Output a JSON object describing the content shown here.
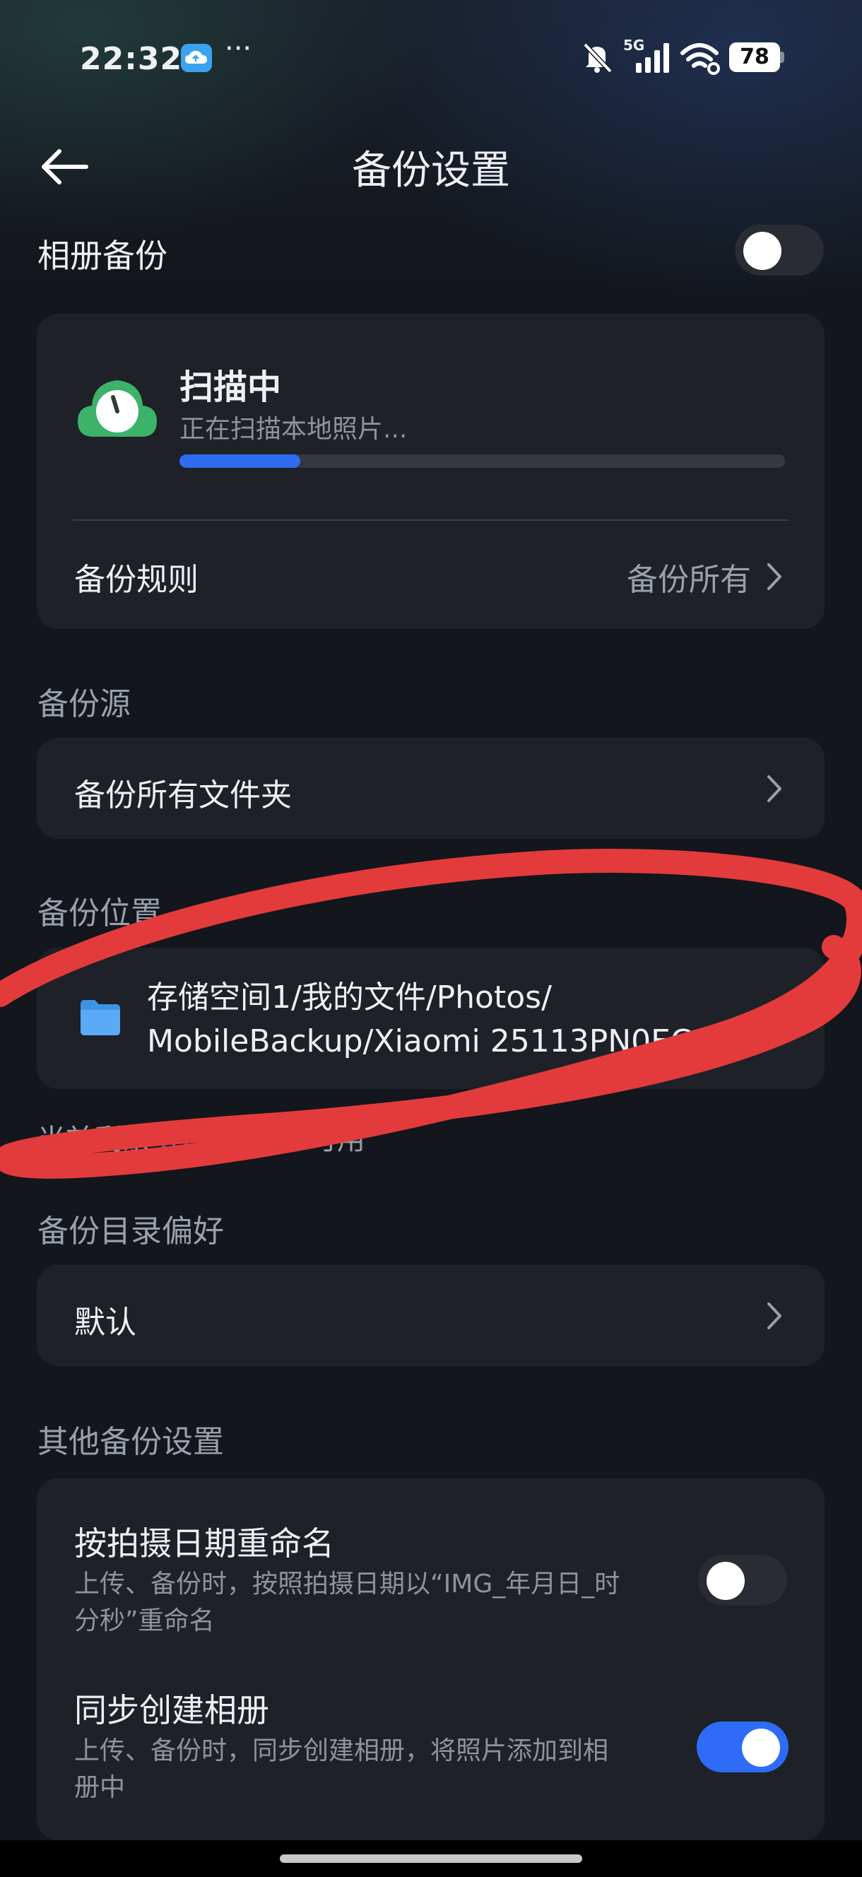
{
  "status_bar": {
    "time": "22:32",
    "overflow_dots": "···",
    "network": "5G",
    "battery": "78"
  },
  "header": {
    "title": "备份设置"
  },
  "album_backup": {
    "label": "相册备份",
    "enabled": false
  },
  "scan": {
    "title": "扫描中",
    "subtitle": "正在扫描本地照片...",
    "progress": 0.2,
    "accent_color": "#2f6bf1",
    "icon": "cloud-clock-icon"
  },
  "rule": {
    "label": "备份规则",
    "value": "备份所有"
  },
  "source": {
    "section_label": "备份源",
    "row_label": "备份所有文件夹"
  },
  "location": {
    "section_label": "备份位置",
    "path_line1": "存储空间1/我的文件/Photos/",
    "path_line2": "MobileBackup/Xiaomi 25113PN0EC",
    "remaining_prefix": "当前剩余",
    "remaining_value": "873.64GB",
    "remaining_suffix": "可用"
  },
  "directory_pref": {
    "section_label": "备份目录偏好",
    "value": "默认"
  },
  "other": {
    "section_label": "其他备份设置",
    "rename": {
      "title": "按拍摄日期重命名",
      "desc_line1": "上传、备份时，按照拍摄日期以“IMG_年月日_时",
      "desc_line2": "分秒”重命名",
      "enabled": false
    },
    "sync_album": {
      "title": "同步创建相册",
      "desc_line1": "上传、备份时，同步创建相册，将照片添加到相",
      "desc_line2": "册中",
      "enabled": true
    }
  },
  "annotation": {
    "color": "#e33b3b"
  }
}
